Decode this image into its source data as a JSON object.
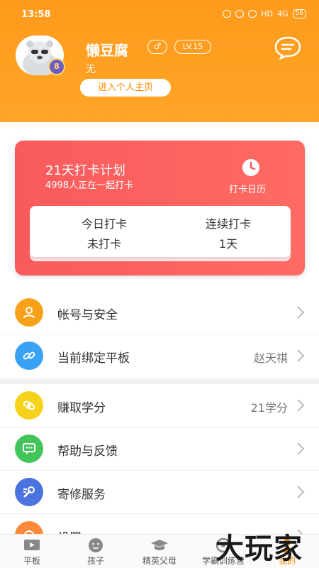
{
  "status": {
    "time": "13:58",
    "hd": "HD",
    "network": "4G",
    "battery": "56"
  },
  "profile": {
    "username": "懒豆腐",
    "gender_symbol": "♂",
    "level": "LV.15",
    "signature": "无",
    "home_button": "进入个人主页"
  },
  "checkin": {
    "title": "21天打卡计划",
    "subtitle": "4998人正在一起打卡",
    "calendar_label": "打卡日历",
    "today_label": "今日打卡",
    "today_value": "未打卡",
    "streak_label": "连续打卡",
    "streak_value": "1天"
  },
  "menu_group1": [
    {
      "label": "帐号与安全",
      "value": "",
      "icon": "user-icon",
      "color": "#f7a11b"
    },
    {
      "label": "当前绑定平板",
      "value": "赵天祺",
      "icon": "link-icon",
      "color": "#3aa2f5"
    }
  ],
  "menu_group2": [
    {
      "label": "赚取学分",
      "value": "21学分",
      "icon": "orbit-icon",
      "color": "#f7d21b"
    },
    {
      "label": "帮助与反馈",
      "value": "",
      "icon": "chat-icon",
      "color": "#43c45a"
    },
    {
      "label": "寄修服务",
      "value": "",
      "icon": "wrench-icon",
      "color": "#4a73e0"
    },
    {
      "label": "设置",
      "value": "",
      "icon": "gear-icon",
      "color": "#ff8a3c"
    }
  ],
  "tabs": [
    {
      "label": "平板",
      "icon": "tablet-icon"
    },
    {
      "label": "孩子",
      "icon": "face-icon"
    },
    {
      "label": "精英父母",
      "icon": "grad-cap-icon"
    },
    {
      "label": "学霸训练营",
      "icon": "target-icon"
    },
    {
      "label": "我的",
      "icon": "person-icon"
    }
  ],
  "watermark": "大玩家",
  "colors": {
    "accent": "#ff9a1c",
    "card": "#f95a5c",
    "active_tab": "#ff8a00"
  }
}
